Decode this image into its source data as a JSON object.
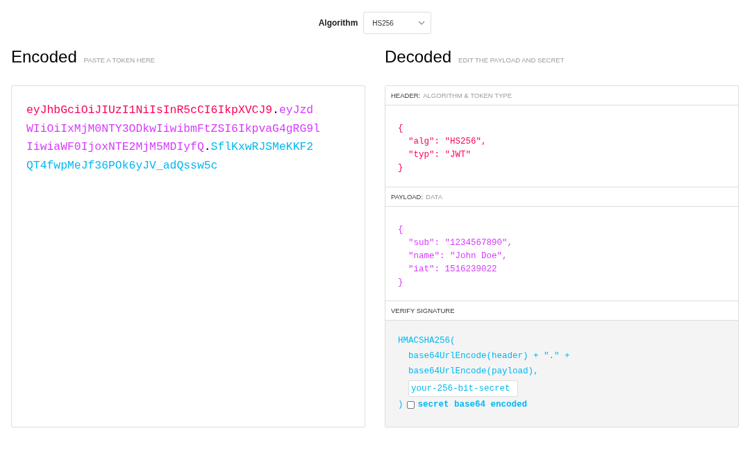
{
  "algorithm": {
    "label": "Algorithm",
    "value": "HS256"
  },
  "encoded": {
    "title": "Encoded",
    "hint": "PASTE A TOKEN HERE",
    "token": [
      {
        "kind": "header",
        "text": "eyJhbGciOiJIUzI1NiIsInR5cCI6IkpXVCJ9"
      },
      {
        "kind": "dot",
        "text": "."
      },
      {
        "kind": "payload",
        "text": "eyJzdWIiOiIxMjM0NTY3ODkwIiwibmFtZSI6IkpvaG4gRG9lIiwiaWF0IjoxNTE2MjM5MDIyfQ"
      },
      {
        "kind": "dot",
        "text": "."
      },
      {
        "kind": "signature",
        "text": "SflKxwRJSMeKKF2QT4fwpMeJf36POk6yJV_adQssw5c"
      }
    ]
  },
  "decoded": {
    "title": "Decoded",
    "hint": "EDIT THE PAYLOAD AND SECRET",
    "header": {
      "label": "HEADER:",
      "sublabel": "ALGORITHM & TOKEN TYPE",
      "open": "{",
      "lines": [
        "\"alg\": \"HS256\",",
        "\"typ\": \"JWT\""
      ],
      "close": "}"
    },
    "payload": {
      "label": "PAYLOAD:",
      "sublabel": "DATA",
      "open": "{",
      "lines": [
        "\"sub\": \"1234567890\",",
        "\"name\": \"John Doe\",",
        "\"iat\": 1516239022"
      ],
      "close": "}"
    },
    "signature": {
      "label": "VERIFY SIGNATURE",
      "open": "HMACSHA256(",
      "lines": [
        "base64UrlEncode(header) + \".\" +",
        "base64UrlEncode(payload),"
      ],
      "secret": "your-256-bit-secret",
      "close": ")",
      "base64": {
        "label": "secret base64 encoded",
        "checked": false
      }
    }
  }
}
